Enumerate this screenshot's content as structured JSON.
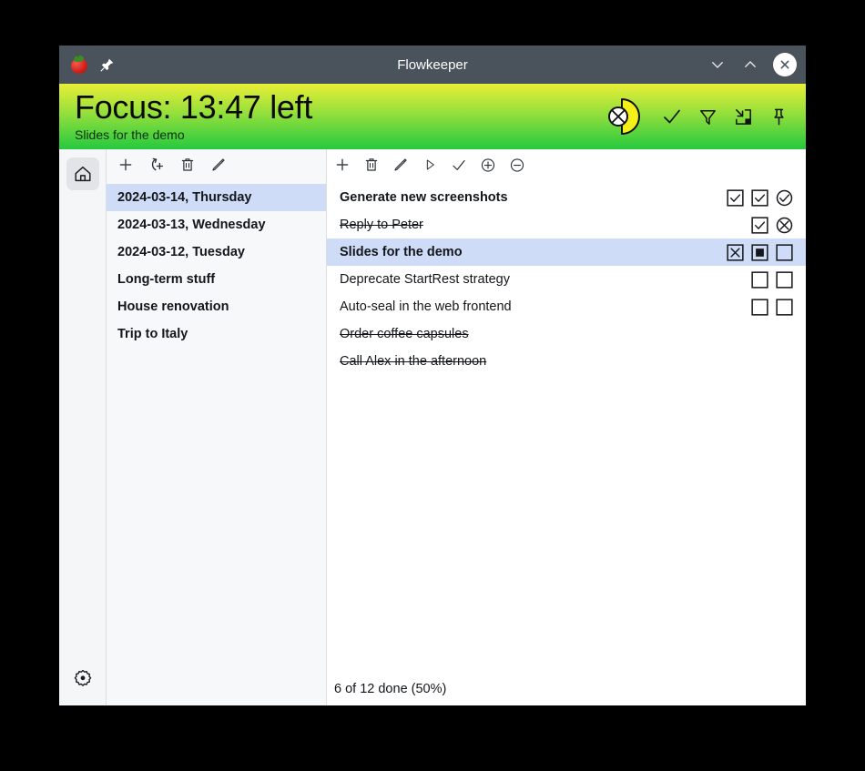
{
  "window": {
    "title": "Flowkeeper",
    "app_icon": "tomato-icon",
    "pin_icon": "pin-icon",
    "controls": {
      "minimize": "chevron-down-icon",
      "maximize": "chevron-up-icon",
      "close": "close-circle-icon"
    }
  },
  "header": {
    "title": "Focus: 13:47 left",
    "subtitle": "Slides for the demo",
    "timer_icon": "timer-pie-void-icon",
    "actions": [
      {
        "name": "complete-icon",
        "label": "check"
      },
      {
        "name": "filter-icon",
        "label": "funnel"
      },
      {
        "name": "dock-icon",
        "label": "move-to-corner"
      },
      {
        "name": "pin-icon",
        "label": "pin"
      }
    ],
    "gradient_top": "#e9ef36",
    "gradient_bottom": "#25c93f"
  },
  "rail": {
    "top_items": [
      {
        "name": "home-icon",
        "active": true
      }
    ],
    "bottom_items": [
      {
        "name": "gear-icon",
        "active": false
      }
    ]
  },
  "sidebar": {
    "toolbar": [
      {
        "name": "add-backlog-button",
        "icon": "plus-icon"
      },
      {
        "name": "add-next-backlog-button",
        "icon": "arrow-plus-icon"
      },
      {
        "name": "delete-backlog-button",
        "icon": "trash-icon"
      },
      {
        "name": "rename-backlog-button",
        "icon": "pencil-icon"
      }
    ],
    "items": [
      {
        "label": "2024-03-14, Thursday",
        "selected": true
      },
      {
        "label": "2024-03-13, Wednesday",
        "selected": false
      },
      {
        "label": "2024-03-12, Tuesday",
        "selected": false
      },
      {
        "label": "Long-term stuff",
        "selected": false
      },
      {
        "label": "House renovation",
        "selected": false
      },
      {
        "label": "Trip to Italy",
        "selected": false
      }
    ]
  },
  "main": {
    "toolbar": [
      {
        "name": "add-task-button",
        "icon": "plus-icon"
      },
      {
        "name": "delete-task-button",
        "icon": "trash-icon"
      },
      {
        "name": "rename-task-button",
        "icon": "pencil-icon"
      },
      {
        "name": "start-task-button",
        "icon": "play-icon"
      },
      {
        "name": "complete-task-button",
        "icon": "check-icon"
      },
      {
        "name": "add-pomodoro-button",
        "icon": "circle-plus-icon"
      },
      {
        "name": "remove-pomodoro-button",
        "icon": "circle-minus-icon"
      }
    ],
    "tasks": [
      {
        "label": "Generate new screenshots",
        "bold": true,
        "struck": false,
        "selected": false,
        "pomodoros": [
          "check-square",
          "check-square",
          "check-circle"
        ]
      },
      {
        "label": "Reply to Peter",
        "bold": false,
        "struck": true,
        "selected": false,
        "pomodoros": [
          "check-square",
          "x-circle"
        ]
      },
      {
        "label": "Slides for the demo",
        "bold": true,
        "struck": false,
        "selected": true,
        "pomodoros": [
          "x-square",
          "filled-square",
          "empty-square"
        ]
      },
      {
        "label": "Deprecate StartRest strategy",
        "bold": false,
        "struck": false,
        "selected": false,
        "pomodoros": [
          "empty-square",
          "empty-square"
        ]
      },
      {
        "label": "Auto-seal in the web frontend",
        "bold": false,
        "struck": false,
        "selected": false,
        "pomodoros": [
          "empty-square",
          "empty-square"
        ]
      },
      {
        "label": "Order coffee capsules",
        "bold": false,
        "struck": true,
        "selected": false,
        "pomodoros": []
      },
      {
        "label": "Call Alex in the afternoon",
        "bold": false,
        "struck": true,
        "selected": false,
        "pomodoros": []
      }
    ],
    "status": "6 of 12 done (50%)"
  },
  "colors": {
    "selection": "#cfdcf7",
    "titlebar": "#4a525c",
    "sidebar_bg": "#f7f8f9"
  }
}
